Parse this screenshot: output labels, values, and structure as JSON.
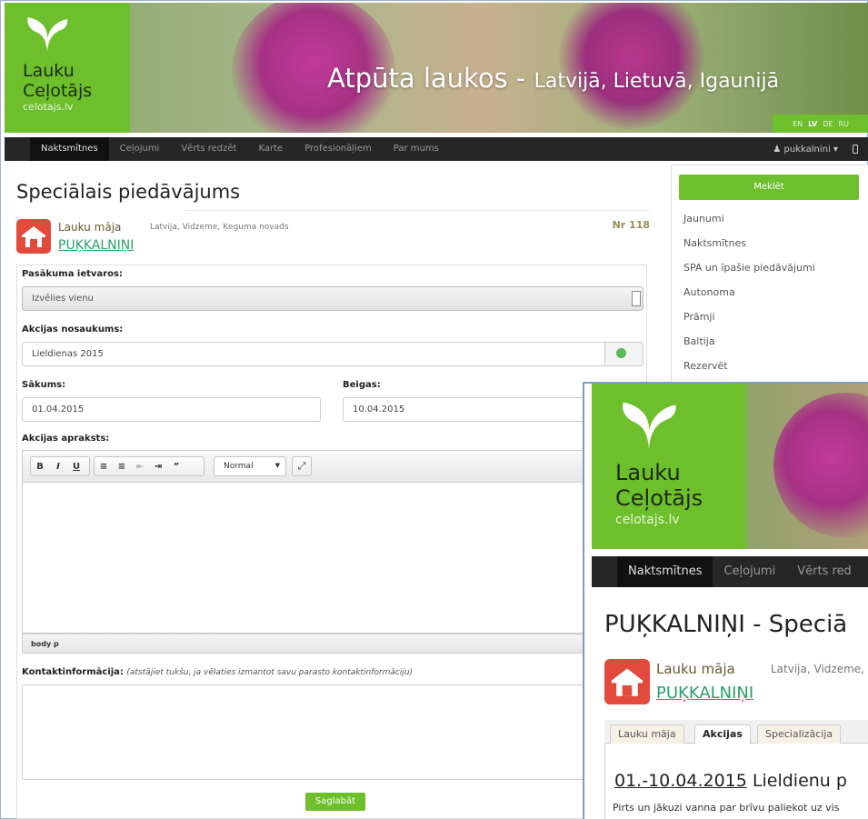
{
  "header": {
    "logo": {
      "line1": "Lauku",
      "line2": "Ceļotājs",
      "line3": "celotajs.lv"
    },
    "title_main": "Atpūta laukos - ",
    "title_sub": "Latvijā, Lietuvā, Igaunijā",
    "languages": [
      "EN",
      "LV",
      "DE",
      "RU"
    ],
    "active_language": "LV"
  },
  "nav": {
    "items": [
      "Naktsmītnes",
      "Ceļojumi",
      "Vērts redzēt",
      "Karte",
      "Profesionāļiem",
      "Par mums"
    ],
    "user": "pukkalnini"
  },
  "main": {
    "title": "Speciālais piedāvājums",
    "object": {
      "type": "Lauku māja",
      "location": "Latvija, Vidzeme, Ķeguma novads",
      "name": "PUĶKALNIŅI",
      "nr": "Nr 118"
    },
    "form": {
      "event_label": "Pasākuma ietvaros:",
      "event_value": "Izvēlies vienu",
      "name_label": "Akcijas nosaukums:",
      "name_value": "Lieldienas 2015",
      "start_label": "Sākums:",
      "start_value": "01.04.2015",
      "end_label": "Beigas:",
      "end_value": "10.04.2015",
      "desc_label": "Akcijas apraksts:",
      "editor_format": "Normal",
      "editor_path": "body  p",
      "contact_label": "Kontaktinformācija:",
      "contact_hint": "(atstājiet tukšu, ja vēlaties izmantot savu parasto kontaktinformāciju)",
      "save_label": "Saglabāt"
    }
  },
  "sidebar": {
    "search_label": "Meklēt",
    "items": [
      "Jaunumi",
      "Naktsmītnes",
      "SPA un īpašie piedāvājumi",
      "Autonoma",
      "Prāmji",
      "Baltija",
      "Rezervēt"
    ]
  },
  "overlay": {
    "logo": {
      "line1": "Lauku",
      "line2": "Ceļotājs",
      "line3": "celotajs.lv"
    },
    "nav": [
      "Naktsmītnes",
      "Ceļojumi",
      "Vērts red"
    ],
    "title": "PUĶKALNIŅI - Speciā",
    "object": {
      "type": "Lauku māja",
      "location": "Latvija, Vidzeme,",
      "name": "PUĶKALNIŅI"
    },
    "tabs": [
      "Lauku māja",
      "Akcijas",
      "Specializācija"
    ],
    "active_tab": "Akcijas",
    "akcija_date": "01.-10.04.2015",
    "akcija_title": " Lieldienu p",
    "akcija_desc": "Pirts un jākuzi vanna par brīvu paliekot uz vis"
  },
  "colors": {
    "brand_green": "#6dbf2c",
    "nav_dark": "#262626",
    "link_green": "#2aa06a",
    "house_red": "#e24a3c"
  }
}
